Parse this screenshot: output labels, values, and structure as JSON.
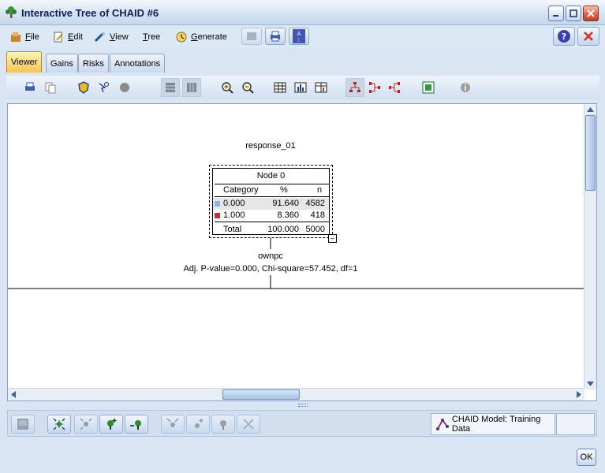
{
  "window": {
    "title": "Interactive Tree of CHAID #6"
  },
  "menu": {
    "file": "File",
    "edit": "Edit",
    "view": "View",
    "tree": "Tree",
    "generate": "Generate"
  },
  "tabs": [
    "Viewer",
    "Gains",
    "Risks",
    "Annotations"
  ],
  "tree": {
    "target": "response_01",
    "node": {
      "name": "Node 0",
      "headers": {
        "category": "Category",
        "pct": "%",
        "n": "n"
      },
      "rows": [
        {
          "category": "0.000",
          "pct": "91.640",
          "n": "4582",
          "color": "#8fb3d9"
        },
        {
          "category": "1.000",
          "pct": "8.360",
          "n": "418",
          "color": "#b03a3a"
        }
      ],
      "total": {
        "label": "Total",
        "pct": "100.000",
        "n": "5000"
      }
    },
    "split_variable": "ownpc",
    "split_stats": "Adj. P-value=0.000, Chi-square=57.452, df=1"
  },
  "status": {
    "model": "CHAID Model: Training Data"
  },
  "buttons": {
    "ok": "OK"
  },
  "colors": {
    "accent": "#f6c54a",
    "frame": "#d9e5f3",
    "close": "#d95e3e"
  }
}
